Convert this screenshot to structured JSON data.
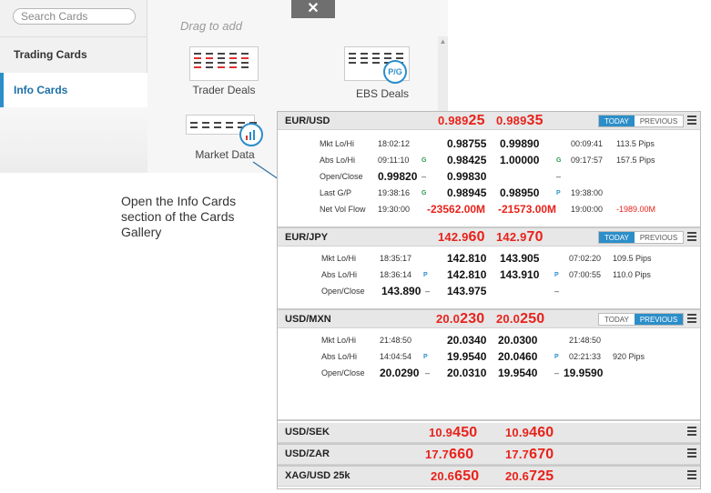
{
  "gallery": {
    "search_placeholder": "Search Cards",
    "sidebar_items": [
      "Trading Cards",
      "Info Cards"
    ],
    "drag_hint": "Drag to add",
    "close_symbol": "✕",
    "thumbnails": [
      {
        "label": "Trader Deals"
      },
      {
        "label": "EBS Deals",
        "badge": "P/G"
      },
      {
        "label": "Market Data"
      }
    ]
  },
  "callout": "Open the Info Cards section of the Cards Gallery",
  "cards": [
    {
      "pair": "EUR/USD",
      "bid": [
        "0.989",
        "25"
      ],
      "ask": [
        "0.989",
        "35"
      ],
      "toggle": [
        "TODAY",
        "PREVIOUS"
      ],
      "active": "TODAY",
      "rows": [
        {
          "label": "Mkt Lo/Hi",
          "t1": "18:02:12",
          "v1": "0.98755",
          "v2": "0.99890",
          "t2": "00:09:41",
          "extra": "113.5 Pips"
        },
        {
          "label": "Abs Lo/Hi",
          "t1": "09:11:10",
          "tag1": "G",
          "v1": "0.98425",
          "v2": "1.00000",
          "tag2": "G",
          "t2": "09:17:57",
          "extra": "157.5 Pips"
        },
        {
          "label": "Open/Close",
          "v0": "0.99820",
          "dash1": "–",
          "v1": "0.99830",
          "dash2": "–"
        },
        {
          "label": "Last G/P",
          "t1": "19:38:16",
          "tag1": "G",
          "v1": "0.98945",
          "v2": "0.98950",
          "tag2": "P",
          "t2": "19:38:00"
        },
        {
          "label": "Net Vol Flow",
          "t1": "19:30:00",
          "v1": "-23562.00M",
          "v2": "-21573.00M",
          "t2": "19:00:00",
          "extra": "-1989.00M"
        }
      ]
    },
    {
      "pair": "EUR/JPY",
      "bid": [
        "142.9",
        "60"
      ],
      "ask": [
        "142.9",
        "70"
      ],
      "toggle": [
        "TODAY",
        "PREVIOUS"
      ],
      "active": "TODAY",
      "rows": [
        {
          "label": "Mkt Lo/Hi",
          "t1": "18:35:17",
          "v1": "142.810",
          "v2": "143.905",
          "t2": "07:02:20",
          "extra": "109.5 Pips"
        },
        {
          "label": "Abs Lo/Hi",
          "t1": "18:36:14",
          "tag1": "P",
          "v1": "142.810",
          "v2": "143.910",
          "tag2": "P",
          "t2": "07:00:55",
          "extra": "110.0 Pips"
        },
        {
          "label": "Open/Close",
          "v0": "143.890",
          "dash1": "–",
          "v1": "143.975",
          "dash2": "–"
        }
      ]
    },
    {
      "pair": "USD/MXN",
      "bid": [
        "20.0",
        "230"
      ],
      "ask": [
        "20.0",
        "250"
      ],
      "toggle": [
        "TODAY",
        "PREVIOUS"
      ],
      "active": "PREVIOUS",
      "rows": [
        {
          "label": "Mkt Lo/Hi",
          "t1": "21:48:50",
          "v1": "20.0340",
          "v2": "20.0300",
          "t2": "21:48:50"
        },
        {
          "label": "Abs Lo/Hi",
          "t1": "14:04:54",
          "tag1": "P",
          "v1": "19.9540",
          "v2": "20.0460",
          "tag2": "P",
          "t2": "02:21:33",
          "extra": "920 Pips"
        },
        {
          "label": "Open/Close",
          "v0": "20.0290",
          "dash1": "–",
          "v1": "20.0310",
          "v2": "19.9540",
          "dash2": "–",
          "v3": "19.9590"
        }
      ]
    },
    {
      "pair": "USD/SEK",
      "bid": [
        "10.9",
        "450"
      ],
      "ask": [
        "10.9",
        "460"
      ]
    },
    {
      "pair": "USD/ZAR",
      "bid": [
        "17.7",
        "660"
      ],
      "ask": [
        "17.7",
        "670"
      ]
    },
    {
      "pair": "XAG/USD 25k",
      "bid": [
        "20.6",
        "650"
      ],
      "ask": [
        "20.6",
        "725"
      ]
    }
  ]
}
